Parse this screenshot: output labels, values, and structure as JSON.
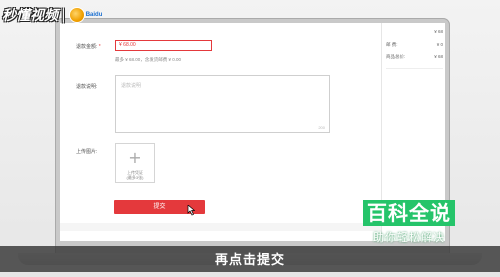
{
  "watermark": {
    "brand_text": "秒懂视频",
    "separator": "|",
    "badge_word": "Baidu"
  },
  "form": {
    "refund_amount": {
      "label": "退款金额:",
      "required_mark": "*",
      "value": "¥ 68.00",
      "hint": "最多 ¥ 68.00，含发货邮费 ¥ 0.00"
    },
    "refund_description": {
      "label": "退款说明:",
      "placeholder": "退款说明",
      "counter": "200"
    },
    "upload_images": {
      "label": "上传图片:",
      "plus": "+",
      "button_line1": "上传凭证",
      "button_line2": "(最多3张)"
    },
    "submit_label": "提交"
  },
  "sidebar": {
    "rows": [
      {
        "label": "",
        "value": "¥ 68"
      },
      {
        "label": "邮    费:",
        "value": "¥ 0"
      },
      {
        "label": "商品总价:",
        "value": "¥ 68"
      }
    ]
  },
  "caption": "再点击提交",
  "baike": {
    "title": "百科全说",
    "subtitle": "助你轻松解决"
  },
  "colors": {
    "accent_red": "#e4393c",
    "baike_green": "#25c46a",
    "caption_bg": "#3c3c3c"
  }
}
